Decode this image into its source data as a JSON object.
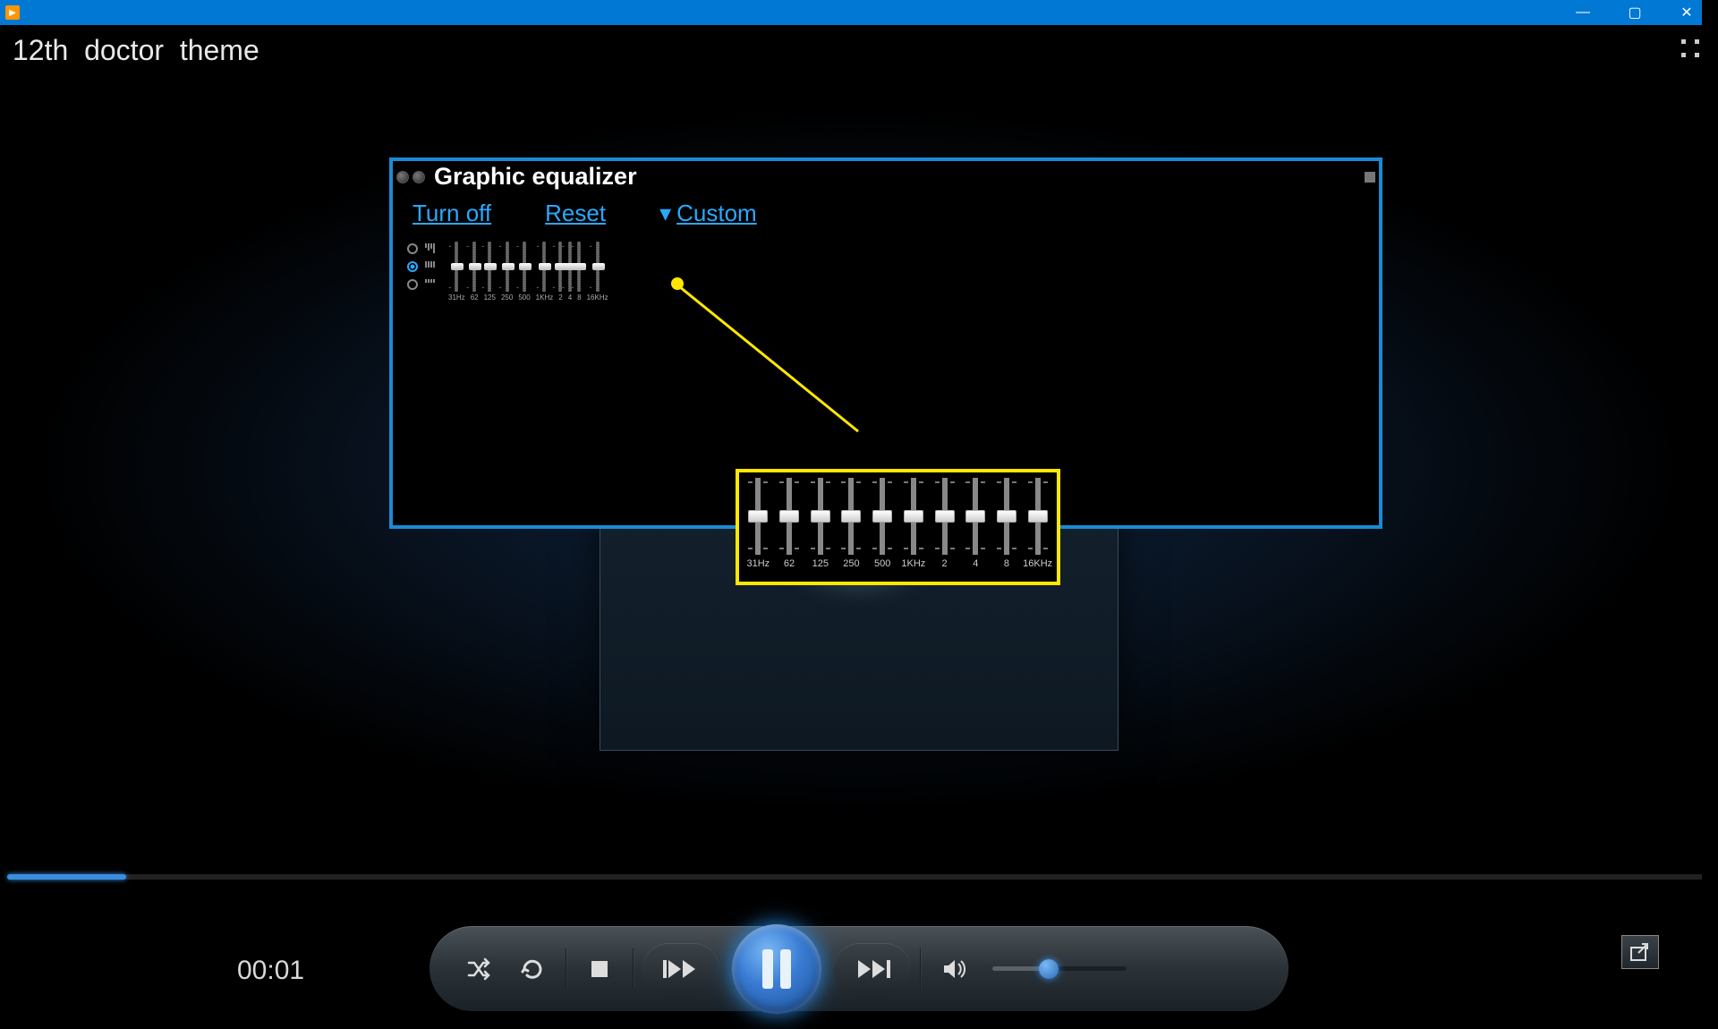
{
  "window": {
    "minimize": "—",
    "maximize": "▢",
    "close": "✕"
  },
  "media": {
    "title": "12th_doctor_theme",
    "time": "00:01"
  },
  "equalizer": {
    "title": "Graphic equalizer",
    "turn_off": "Turn off",
    "reset": "Reset",
    "preset": "Custom",
    "bands": [
      "31Hz",
      "62",
      "125",
      "250",
      "500",
      "1KHz",
      "2",
      "4",
      "8",
      "16KHz"
    ]
  }
}
